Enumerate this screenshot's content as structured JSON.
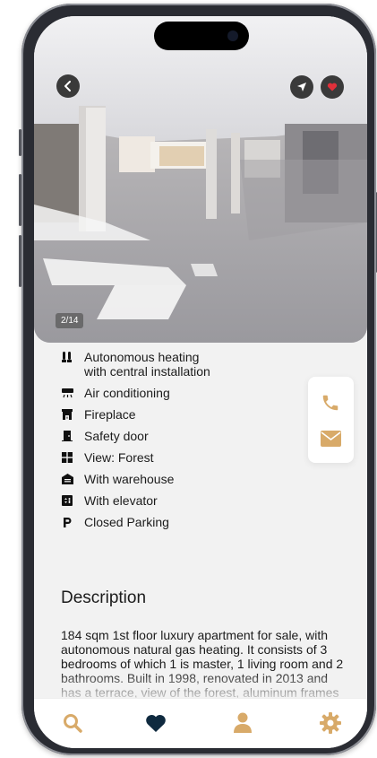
{
  "gallery": {
    "counter": "2/14"
  },
  "colors": {
    "accent": "#d8aa69",
    "dark": "#0f2a3f",
    "favorite": "#e0303a"
  },
  "icons": {
    "back": "chevron-left-icon",
    "navigate": "location-arrow-icon",
    "favorite": "heart-icon",
    "phone": "phone-icon",
    "email": "envelope-icon"
  },
  "features": [
    {
      "icon": "heating-icon",
      "line1": "Autonomous heating",
      "line2": "with central installation"
    },
    {
      "icon": "air-conditioner-icon",
      "line1": "Air conditioning"
    },
    {
      "icon": "fireplace-icon",
      "line1": "Fireplace"
    },
    {
      "icon": "door-icon",
      "line1": "Safety door"
    },
    {
      "icon": "grid-view-icon",
      "line1": "View: Forest"
    },
    {
      "icon": "warehouse-icon",
      "line1": "With warehouse"
    },
    {
      "icon": "elevator-icon",
      "line1": "With elevator"
    },
    {
      "icon": "parking-icon",
      "line1": "Closed Parking"
    }
  ],
  "description": {
    "title": "Description",
    "text": "184 sqm 1st floor luxury apartment for sale, with autonomous natural gas heating. It consists of 3 bedrooms of which 1 is master, 1 living room and 2 bathrooms. Built in 1998, renovated in 2013 and has a terrace, view of the forest, aluminum frames"
  },
  "tabs": [
    {
      "icon": "search-icon",
      "active": false
    },
    {
      "icon": "heart-icon",
      "active": true
    },
    {
      "icon": "user-icon",
      "active": false
    },
    {
      "icon": "gear-icon",
      "active": false
    }
  ]
}
